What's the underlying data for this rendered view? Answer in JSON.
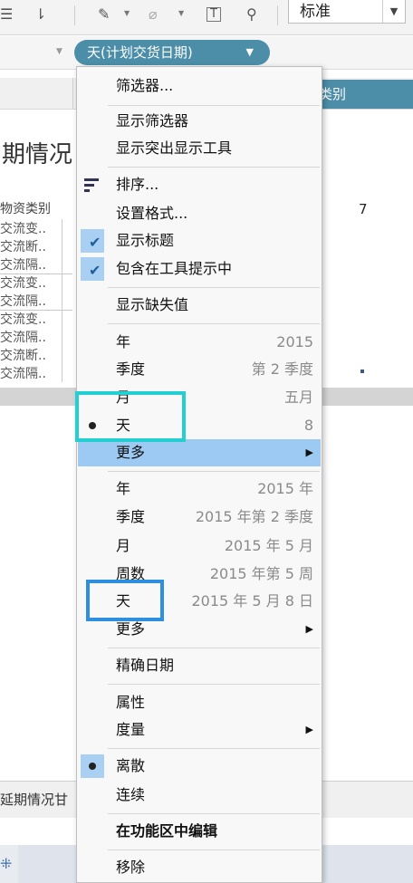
{
  "toolbar": {
    "format_select": "标准",
    "icons": [
      "sort-descending-icon",
      "highlighter-icon",
      "paperclip-icon",
      "text-label-icon",
      "pin-icon"
    ]
  },
  "pill": {
    "label": "天(计划交货日期)"
  },
  "header": {
    "blue_label": "类别"
  },
  "sheet": {
    "title": "期情况",
    "column_header": "物资类别",
    "first_value": "7",
    "rows": [
      "交流变..",
      "交流断..",
      "交流隔..",
      "交流变..",
      "交流隔..",
      "交流变..",
      "交流隔..",
      "交流断..",
      "交流隔.."
    ]
  },
  "bottom": {
    "tab_label": "延期情况甘"
  },
  "menu": {
    "filter": "筛选器...",
    "show_filter": "显示筛选器",
    "show_highlighter": "显示突出显示工具",
    "sort": "排序...",
    "format": "设置格式...",
    "show_header": "显示标题",
    "include_tooltip": "包含在工具提示中",
    "show_missing": "显示缺失值",
    "part": [
      {
        "label": "年",
        "value": "2015"
      },
      {
        "label": "季度",
        "value": "第 2 季度"
      },
      {
        "label": "月",
        "value": "五月"
      },
      {
        "label": "天",
        "value": "8"
      }
    ],
    "more1": "更多",
    "exact": [
      {
        "label": "年",
        "value": "2015 年"
      },
      {
        "label": "季度",
        "value": "2015 年第 2 季度"
      },
      {
        "label": "月",
        "value": "2015 年 5 月"
      },
      {
        "label": "周数",
        "value": "2015 年第 5 周"
      },
      {
        "label": "天",
        "value": "2015 年 5 月 8 日"
      }
    ],
    "more2": "更多",
    "exact_date": "精确日期",
    "attribute": "属性",
    "measure": "度量",
    "discrete": "离散",
    "continuous": "连续",
    "edit_in_shelf": "在功能区中编辑",
    "remove": "移除"
  }
}
